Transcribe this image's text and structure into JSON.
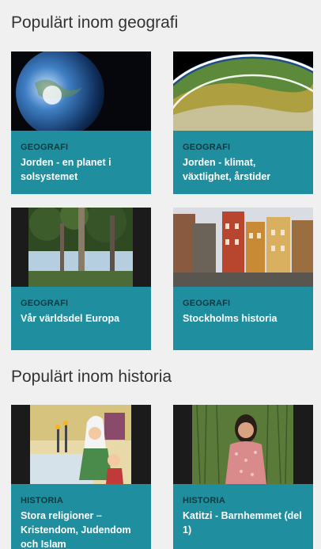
{
  "sections": [
    {
      "title": "Populärt inom geografi",
      "cards": [
        {
          "category": "GEOGRAFI",
          "title": "Jorden - en planet i solsystemet",
          "thumbnail": "earth-in-space"
        },
        {
          "category": "GEOGRAFI",
          "title": "Jorden - klimat, växtlighet, årstider",
          "thumbnail": "earth-closeup"
        },
        {
          "category": "GEOGRAFI",
          "title": "Vår världsdel Europa",
          "thumbnail": "forest-trees"
        },
        {
          "category": "GEOGRAFI",
          "title": "Stockholms historia",
          "thumbnail": "stockholm-square"
        }
      ]
    },
    {
      "title": "Populärt inom historia",
      "cards": [
        {
          "category": "HISTORIA",
          "title": "Stora religioner – Kristendom, Judendom och Islam",
          "thumbnail": "religion-illustration"
        },
        {
          "category": "HISTORIA",
          "title": "Katitzi - Barnhemmet (del 1)",
          "thumbnail": "girl-in-grass"
        }
      ]
    }
  ],
  "colors": {
    "card_bg": "#1f8fa0",
    "category_text": "#0f3a41",
    "page_bg": "#f0f0f1"
  }
}
